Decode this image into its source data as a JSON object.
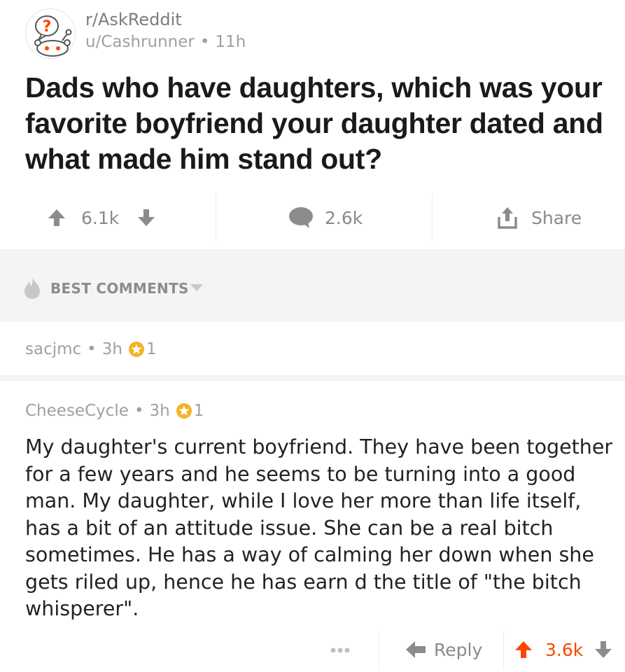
{
  "post": {
    "subreddit": "r/AskReddit",
    "author": "u/Cashrunner",
    "separator": "•",
    "age": "11h",
    "title": "Dads who have daughters, which was your favorite boyfriend your daughter dated and what made him stand out?",
    "upvotes": "6.1k",
    "comment_count": "2.6k",
    "share_label": "Share"
  },
  "comments_header": {
    "sort_label": "BEST COMMENTS"
  },
  "comments": [
    {
      "author": "sacjmc",
      "separator": "•",
      "age": "3h",
      "awards": "1"
    },
    {
      "author": "CheeseCycle",
      "separator": "•",
      "age": "3h",
      "awards": "1",
      "body": "My daughter's current boyfriend. They have been together for a few years and he seems to be turning into a good man.  My daughter, while I love her more than life itself, has a bit of an attitude issue. She can be a real bitch sometimes.  He has a way of calming her down when she gets riled up, hence he has earn d the title of \"the bitch whisperer\".",
      "reply_label": "Reply",
      "score": "3.6k"
    }
  ],
  "colors": {
    "upvote_active": "#ff4500",
    "icon_gray": "#8c8c8c",
    "award_gold": "#f0b52b"
  },
  "icons": [
    "askreddit-snoo-icon",
    "upvote-icon",
    "downvote-icon",
    "comment-icon",
    "share-icon",
    "flame-icon",
    "caret-down-icon",
    "award-icon",
    "more-icon",
    "reply-icon"
  ]
}
